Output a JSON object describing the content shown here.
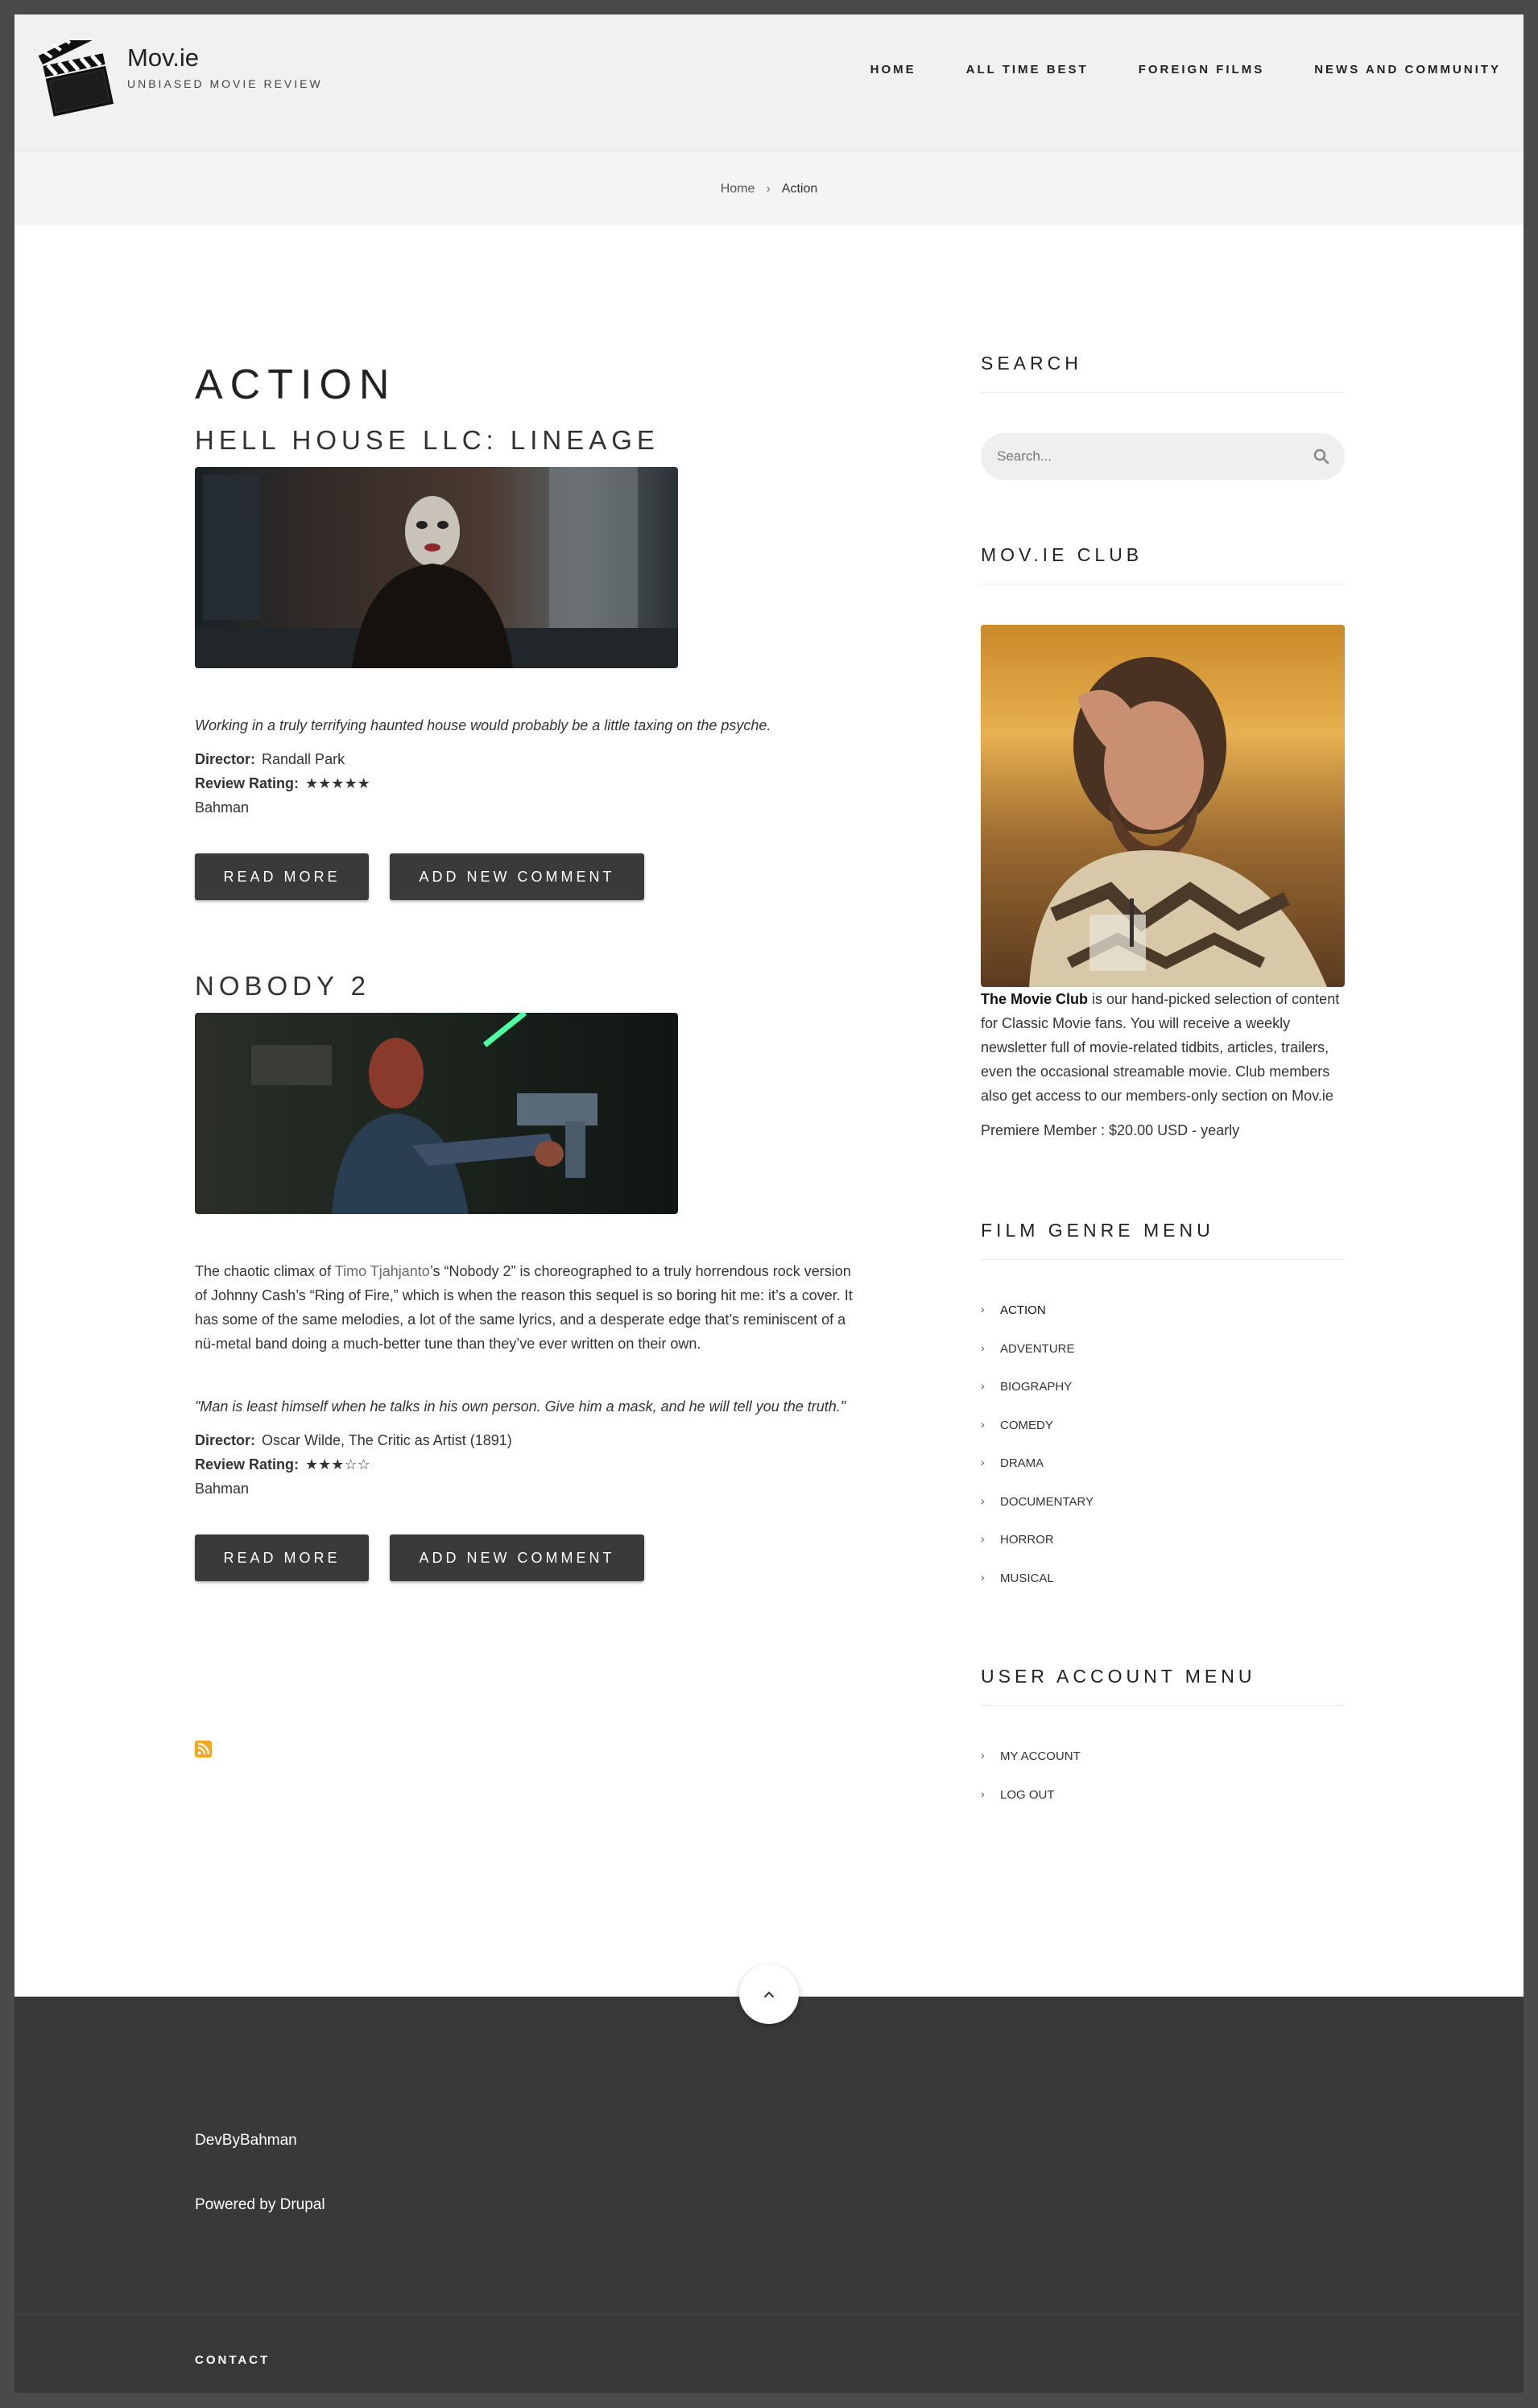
{
  "header": {
    "site_name": "Mov.ie",
    "slogan": "UNBIASED MOVIE REVIEW",
    "nav": [
      "HOME",
      "ALL TIME BEST",
      "FOREIGN FILMS",
      "NEWS AND COMMUNITY"
    ]
  },
  "breadcrumb": {
    "home": "Home",
    "separator": "›",
    "current": "Action"
  },
  "main": {
    "page_title": "ACTION",
    "articles": [
      {
        "title": "HELL HOUSE LLC: LINEAGE",
        "teaser": "Working in a truly terrifying haunted house would probably be a little taxing on the psyche.",
        "director_label": "Director:",
        "director": "Randall Park",
        "rating_label": "Review Rating:",
        "rating_stars": "★★★★★",
        "author": "Bahman",
        "read_more": "READ MORE",
        "add_comment": "ADD NEW COMMENT"
      },
      {
        "title": "NOBODY 2",
        "body_pre": "The chaotic climax of ",
        "body_link": "Timo Tjahjanto",
        "body_post": "’s “Nobody 2” is choreographed to a truly horrendous rock version of Johnny Cash’s “Ring of Fire,” which is when the reason this sequel is so boring hit me: it’s a cover. It has some of the same melodies, a lot of the same lyrics, and a desperate edge that’s reminiscent of a nü-metal band doing a much-better tune than they’ve ever written on their own.",
        "teaser": "\"Man is least himself when he talks in his own person. Give him a mask, and he will tell you the truth.\"",
        "director_label": "Director:",
        "director": "Oscar Wilde, The Critic as Artist (1891)",
        "rating_label": "Review Rating:",
        "rating_stars": "★★★☆☆",
        "author": "Bahman",
        "read_more": "READ MORE",
        "add_comment": "ADD NEW COMMENT"
      }
    ]
  },
  "sidebar": {
    "search_title": "SEARCH",
    "search_placeholder": "Search...",
    "club_title": "MOV.IE CLUB",
    "club_bold": "The Movie Club",
    "club_text": " is our hand-picked selection of content for Classic Movie fans. You will receive a weekly newsletter full of movie-related tidbits, articles, trailers, even the occasional streamable movie. Club members also get access to our members-only section on Mov.ie",
    "premiere": "Premiere Member : $20.00 USD - yearly",
    "genre_title": "FILM GENRE MENU",
    "genres": [
      "ACTION",
      "ADVENTURE",
      "BIOGRAPHY",
      "COMEDY",
      "DRAMA",
      "DOCUMENTARY",
      "HORROR",
      "MUSICAL"
    ],
    "account_title": "USER ACCOUNT MENU",
    "account_items": [
      "MY ACCOUNT",
      "LOG OUT"
    ]
  },
  "footer": {
    "credit": "DevByBahman",
    "powered": "Powered by Drupal",
    "contact": "CONTACT"
  },
  "icons": {
    "logo": "clapperboard-icon",
    "search": "search-icon",
    "feed": "rss-icon",
    "to_top": "chevron-up-icon",
    "menu_bullet": "chevron-right-icon"
  }
}
